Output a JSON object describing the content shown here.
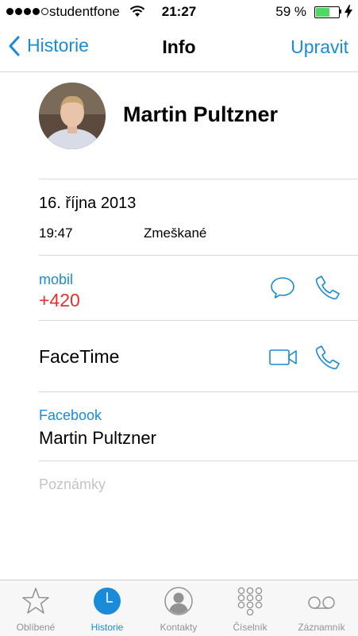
{
  "status_bar": {
    "carrier": "studentfone",
    "time": "21:27",
    "battery_percent": "59 %",
    "battery_level": 0.59,
    "signal_bars": 4
  },
  "nav": {
    "back_label": "Historie",
    "title": "Info",
    "edit_label": "Upravit"
  },
  "contact": {
    "name": "Martin Pultzner"
  },
  "call": {
    "date": "16. října 2013",
    "time": "19:47",
    "status": "Zmeškané"
  },
  "phone": {
    "label": "mobil",
    "number": "+420"
  },
  "facetime": {
    "label": "FaceTime"
  },
  "facebook": {
    "label": "Facebook",
    "name": "Martin Pultzner"
  },
  "notes": {
    "placeholder": "Poznámky"
  },
  "tab_bar": {
    "items": [
      {
        "label": "Oblíbené",
        "icon": "star-icon"
      },
      {
        "label": "Historie",
        "icon": "clock-icon",
        "active": true
      },
      {
        "label": "Kontakty",
        "icon": "contact-icon"
      },
      {
        "label": "Číselník",
        "icon": "keypad-icon"
      },
      {
        "label": "Záznamník",
        "icon": "voicemail-icon"
      }
    ]
  },
  "colors": {
    "accent": "#1a8bd8",
    "missed_red": "#e1322c",
    "battery_green": "#4cd964"
  }
}
